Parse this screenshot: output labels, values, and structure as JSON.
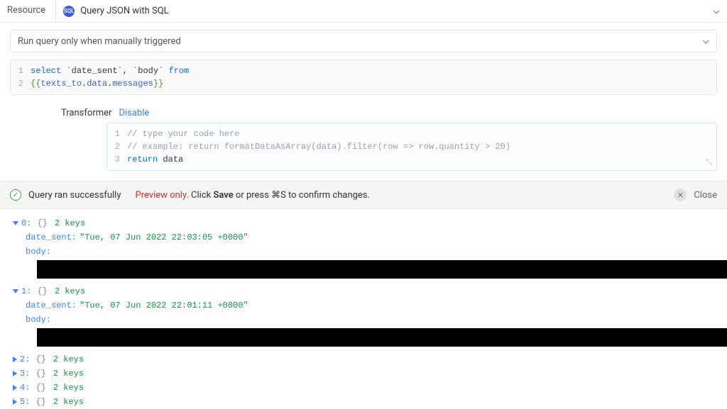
{
  "resource": {
    "tab_label": "Resource",
    "type_label": "Query JSON with SQL",
    "badge": "SQL"
  },
  "run_mode": {
    "label": "Run query only when manually triggered"
  },
  "sql_editor": {
    "lines": [
      {
        "n": "1",
        "html": "<span class='kw'>select</span> `date_sent`, `body` <span class='kw'>from</span>"
      },
      {
        "n": "2",
        "html": "<span class='brace-out'>{{</span><span class='brace-in'>texts_to</span><span class='dot'>.</span><span class='brace-in'>data</span><span class='dot'>.</span><span class='brace-in'>messages</span><span class='brace-out'>}}</span>"
      }
    ]
  },
  "transformer": {
    "label": "Transformer",
    "disable": "Disable",
    "lines": [
      {
        "n": "1",
        "html": "<span class='cmt'>// type your code here</span>"
      },
      {
        "n": "2",
        "html": "<span class='cmt'>// example: return formatDataAsArray(data).filter(row =&gt; row.quantity &gt; 20)</span>"
      },
      {
        "n": "3",
        "html": "<span class='kw'>return</span> data"
      }
    ]
  },
  "status": {
    "success_text": "Query ran successfully",
    "preview_prefix": "Preview only.",
    "preview_rest_a": " Click ",
    "preview_save": "Save",
    "preview_rest_b": " or press ",
    "preview_keys": "⌘S",
    "preview_rest_c": " to confirm changes.",
    "close_label": "Close"
  },
  "results": {
    "keys_label": "2 keys",
    "expanded": [
      {
        "index": "0:",
        "fields": [
          {
            "key": "date_sent:",
            "value": "\"Tue, 07 Jun 2022 22:03:05 +0000\""
          },
          {
            "key": "body:",
            "value": ""
          }
        ]
      },
      {
        "index": "1:",
        "fields": [
          {
            "key": "date_sent:",
            "value": "\"Tue, 07 Jun 2022 22:01:11 +0000\""
          },
          {
            "key": "body:",
            "value": ""
          }
        ]
      }
    ],
    "collapsed": [
      {
        "index": "2:"
      },
      {
        "index": "3:"
      },
      {
        "index": "4:"
      },
      {
        "index": "5:"
      }
    ]
  }
}
